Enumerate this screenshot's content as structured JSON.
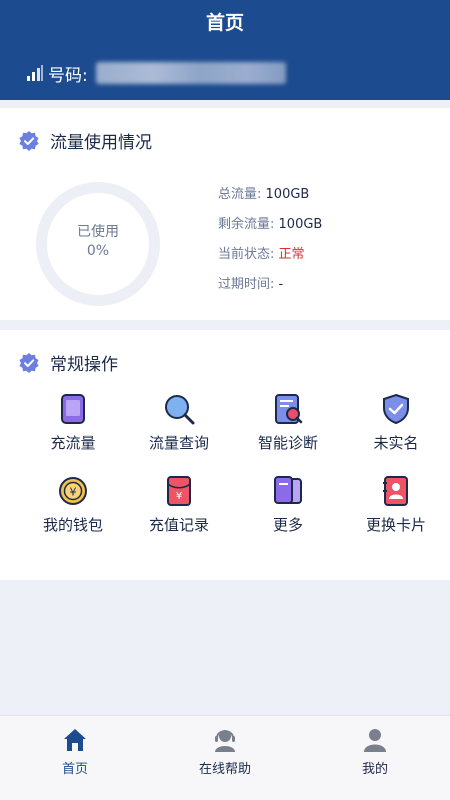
{
  "header": {
    "title": "首页",
    "phone_label": "号码:"
  },
  "usage": {
    "title": "流量使用情况",
    "used_label": "已使用",
    "used_percent": "0%",
    "used_fraction": 0,
    "stats": [
      {
        "label": "总流量:",
        "value": "100GB"
      },
      {
        "label": "剩余流量:",
        "value": "100GB"
      },
      {
        "label": "当前状态:",
        "value": "正常"
      },
      {
        "label": "过期时间:",
        "value": "-"
      }
    ]
  },
  "ops": {
    "title": "常规操作",
    "items": [
      {
        "label": "充流量",
        "icon": "tablet-icon"
      },
      {
        "label": "流量查询",
        "icon": "magnifier-icon"
      },
      {
        "label": "智能诊断",
        "icon": "document-search-icon"
      },
      {
        "label": "未实名",
        "icon": "shield-check-icon"
      },
      {
        "label": "我的钱包",
        "icon": "yuan-coin-icon"
      },
      {
        "label": "充值记录",
        "icon": "red-envelope-icon"
      },
      {
        "label": "更多",
        "icon": "cards-icon"
      },
      {
        "label": "更换卡片",
        "icon": "id-card-icon"
      }
    ]
  },
  "tabs": [
    {
      "label": "首页",
      "icon": "home-icon",
      "active": true
    },
    {
      "label": "在线帮助",
      "icon": "headset-icon",
      "active": false
    },
    {
      "label": "我的",
      "icon": "user-icon",
      "active": false
    }
  ],
  "colors": {
    "primary": "#1d4b8f",
    "status_normal": "#d6322b",
    "background": "#eef0f7"
  }
}
